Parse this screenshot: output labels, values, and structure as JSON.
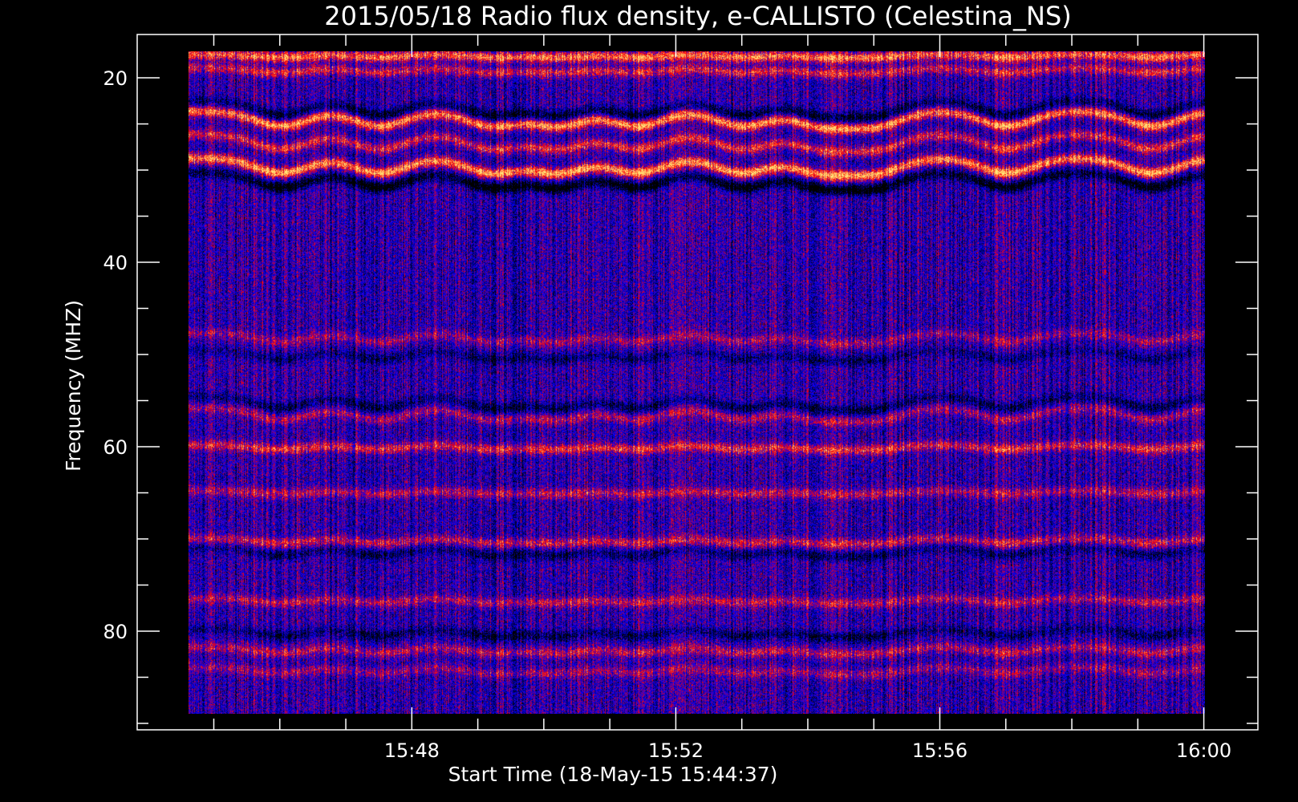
{
  "chart_data": {
    "type": "heatmap",
    "title": "2015/05/18  Radio flux density, e-CALLISTO (Celestina_NS)",
    "xlabel": "Start Time (18-May-15 15:44:37)",
    "ylabel": "Frequency (MHZ)",
    "x": {
      "unit": "minutes after 15:44:37",
      "range": [
        0,
        15.4
      ],
      "major_ticks": [
        {
          "label": "15:48",
          "value": 3.383
        },
        {
          "label": "15:52",
          "value": 7.383
        },
        {
          "label": "15:56",
          "value": 11.383
        },
        {
          "label": "16:00",
          "value": 15.383
        }
      ],
      "minor_tick_step": 1
    },
    "y": {
      "unit": "MHz",
      "range": [
        89,
        17
      ],
      "inverted": true,
      "major_ticks": [
        20,
        40,
        60,
        80
      ],
      "minor_tick_step": 5,
      "axis_range": [
        15.3,
        90.7
      ]
    },
    "colormap": [
      "#000000",
      "#0000ff",
      "#ff0000",
      "#ffff80"
    ],
    "background_color": "#2626e6",
    "features": [
      {
        "type": "band",
        "freq_mhz": 17.3,
        "intensity": 0.85,
        "wiggle": 0.2
      },
      {
        "type": "band",
        "freq_mhz": 18.8,
        "intensity": 0.55,
        "wiggle": 0.3
      },
      {
        "type": "band",
        "freq_mhz": 23.5,
        "intensity": 0.95,
        "wiggle": 1.0
      },
      {
        "type": "band",
        "freq_mhz": 26.0,
        "intensity": 0.6,
        "wiggle": 1.0
      },
      {
        "type": "band",
        "freq_mhz": 28.6,
        "intensity": 1.0,
        "wiggle": 1.0
      },
      {
        "type": "dark",
        "freq_mhz": 30.2,
        "intensity": 0.9,
        "wiggle": 1.0
      },
      {
        "type": "dark",
        "freq_mhz": 22.3,
        "intensity": 0.6,
        "wiggle": 1.0
      },
      {
        "type": "band",
        "freq_mhz": 47.6,
        "intensity": 0.35,
        "wiggle": 0.6
      },
      {
        "type": "dark",
        "freq_mhz": 49.5,
        "intensity": 0.4,
        "wiggle": 0.6
      },
      {
        "type": "dark",
        "freq_mhz": 54.5,
        "intensity": 0.5,
        "wiggle": 0.8
      },
      {
        "type": "band",
        "freq_mhz": 55.8,
        "intensity": 0.4,
        "wiggle": 0.8
      },
      {
        "type": "band",
        "freq_mhz": 59.8,
        "intensity": 0.6,
        "wiggle": 0.3
      },
      {
        "type": "band",
        "freq_mhz": 64.8,
        "intensity": 0.45,
        "wiggle": 0.2
      },
      {
        "type": "band",
        "freq_mhz": 70.0,
        "intensity": 0.5,
        "wiggle": 0.3
      },
      {
        "type": "dark",
        "freq_mhz": 71.0,
        "intensity": 0.45,
        "wiggle": 0.5
      },
      {
        "type": "band",
        "freq_mhz": 76.5,
        "intensity": 0.45,
        "wiggle": 0.3
      },
      {
        "type": "dark",
        "freq_mhz": 79.8,
        "intensity": 0.5,
        "wiggle": 0.5
      },
      {
        "type": "band",
        "freq_mhz": 81.8,
        "intensity": 0.45,
        "wiggle": 0.4
      },
      {
        "type": "band",
        "freq_mhz": 84.0,
        "intensity": 0.35,
        "wiggle": 0.4
      }
    ],
    "bursts_minutes": [
      1.4,
      2.9,
      4.6,
      5.6,
      6.8,
      8.4,
      9.6,
      10.4,
      12.4,
      14.6
    ]
  }
}
